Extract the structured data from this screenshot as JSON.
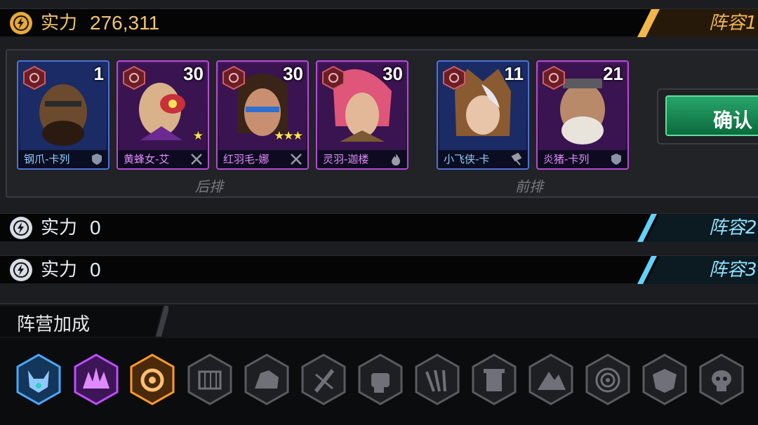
{
  "lineups": [
    {
      "power_label": "实力",
      "power_value": "276,311",
      "lineup_name": "阵容1",
      "active": true
    },
    {
      "power_label": "实力",
      "power_value": "0",
      "lineup_name": "阵容2",
      "active": false
    },
    {
      "power_label": "实力",
      "power_value": "0",
      "lineup_name": "阵容3",
      "active": false
    }
  ],
  "heroes": [
    {
      "name": "钢爪-卡列",
      "level": "1",
      "stars": "",
      "frame": "blue",
      "class_icon": "tank-icon"
    },
    {
      "name": "黄蜂女-艾",
      "level": "30",
      "stars": "★",
      "frame": "purple",
      "class_icon": "crossed-swords-icon"
    },
    {
      "name": "红羽毛-娜",
      "level": "30",
      "stars": "★★★",
      "frame": "purple",
      "class_icon": "crossed-swords-icon"
    },
    {
      "name": "灵羽-迦楼",
      "level": "30",
      "stars": "",
      "frame": "purple",
      "class_icon": "flame-icon"
    },
    {
      "name": "小飞侠-卡",
      "level": "11",
      "stars": "",
      "frame": "blue",
      "class_icon": "hammer-icon"
    },
    {
      "name": "炎猪-卡列",
      "level": "21",
      "stars": "",
      "frame": "purple",
      "class_icon": "tank-icon"
    }
  ],
  "rows": {
    "back": "后排",
    "front": "前排"
  },
  "confirm_label": "确认",
  "faction_bonus_title": "阵营加成",
  "faction_icons": [
    {
      "name": "wolf-faction-icon",
      "color": "#4aa8ff",
      "active": true
    },
    {
      "name": "beast-faction-icon",
      "color": "#c04cff",
      "active": true
    },
    {
      "name": "gear-faction-icon",
      "color": "#ff9a2a",
      "active": true
    },
    {
      "name": "cage-faction-icon",
      "color": "#5a5b60",
      "active": false
    },
    {
      "name": "rock-faction-icon",
      "color": "#5a5b60",
      "active": false
    },
    {
      "name": "blade-faction-icon",
      "color": "#5a5b60",
      "active": false
    },
    {
      "name": "fist-faction-icon",
      "color": "#5a5b60",
      "active": false
    },
    {
      "name": "claw-faction-icon",
      "color": "#5a5b60",
      "active": false
    },
    {
      "name": "tower-faction-icon",
      "color": "#5a5b60",
      "active": false
    },
    {
      "name": "mountain-faction-icon",
      "color": "#5a5b60",
      "active": false
    },
    {
      "name": "spiral-faction-icon",
      "color": "#5a5b60",
      "active": false
    },
    {
      "name": "shield-faction-icon",
      "color": "#5a5b60",
      "active": false
    },
    {
      "name": "skull-faction-icon",
      "color": "#5a5b60",
      "active": false
    }
  ],
  "colors": {
    "active_accent": "#e8a83a",
    "inactive_accent": "#5fd2ff",
    "blue_frame": "#4f72d8",
    "purple_frame": "#b64ad8",
    "confirm_green": "#1a8a52"
  }
}
